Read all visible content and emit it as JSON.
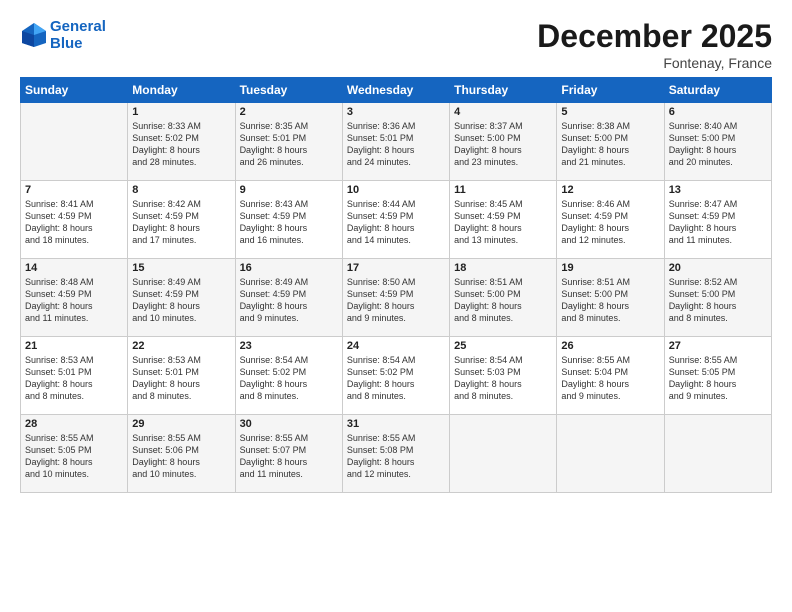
{
  "header": {
    "logo_line1": "General",
    "logo_line2": "Blue",
    "month": "December 2025",
    "location": "Fontenay, France"
  },
  "days_of_week": [
    "Sunday",
    "Monday",
    "Tuesday",
    "Wednesday",
    "Thursday",
    "Friday",
    "Saturday"
  ],
  "weeks": [
    [
      {
        "day": "",
        "info": ""
      },
      {
        "day": "1",
        "info": "Sunrise: 8:33 AM\nSunset: 5:02 PM\nDaylight: 8 hours\nand 28 minutes."
      },
      {
        "day": "2",
        "info": "Sunrise: 8:35 AM\nSunset: 5:01 PM\nDaylight: 8 hours\nand 26 minutes."
      },
      {
        "day": "3",
        "info": "Sunrise: 8:36 AM\nSunset: 5:01 PM\nDaylight: 8 hours\nand 24 minutes."
      },
      {
        "day": "4",
        "info": "Sunrise: 8:37 AM\nSunset: 5:00 PM\nDaylight: 8 hours\nand 23 minutes."
      },
      {
        "day": "5",
        "info": "Sunrise: 8:38 AM\nSunset: 5:00 PM\nDaylight: 8 hours\nand 21 minutes."
      },
      {
        "day": "6",
        "info": "Sunrise: 8:40 AM\nSunset: 5:00 PM\nDaylight: 8 hours\nand 20 minutes."
      }
    ],
    [
      {
        "day": "7",
        "info": "Sunrise: 8:41 AM\nSunset: 4:59 PM\nDaylight: 8 hours\nand 18 minutes."
      },
      {
        "day": "8",
        "info": "Sunrise: 8:42 AM\nSunset: 4:59 PM\nDaylight: 8 hours\nand 17 minutes."
      },
      {
        "day": "9",
        "info": "Sunrise: 8:43 AM\nSunset: 4:59 PM\nDaylight: 8 hours\nand 16 minutes."
      },
      {
        "day": "10",
        "info": "Sunrise: 8:44 AM\nSunset: 4:59 PM\nDaylight: 8 hours\nand 14 minutes."
      },
      {
        "day": "11",
        "info": "Sunrise: 8:45 AM\nSunset: 4:59 PM\nDaylight: 8 hours\nand 13 minutes."
      },
      {
        "day": "12",
        "info": "Sunrise: 8:46 AM\nSunset: 4:59 PM\nDaylight: 8 hours\nand 12 minutes."
      },
      {
        "day": "13",
        "info": "Sunrise: 8:47 AM\nSunset: 4:59 PM\nDaylight: 8 hours\nand 11 minutes."
      }
    ],
    [
      {
        "day": "14",
        "info": "Sunrise: 8:48 AM\nSunset: 4:59 PM\nDaylight: 8 hours\nand 11 minutes."
      },
      {
        "day": "15",
        "info": "Sunrise: 8:49 AM\nSunset: 4:59 PM\nDaylight: 8 hours\nand 10 minutes."
      },
      {
        "day": "16",
        "info": "Sunrise: 8:49 AM\nSunset: 4:59 PM\nDaylight: 8 hours\nand 9 minutes."
      },
      {
        "day": "17",
        "info": "Sunrise: 8:50 AM\nSunset: 4:59 PM\nDaylight: 8 hours\nand 9 minutes."
      },
      {
        "day": "18",
        "info": "Sunrise: 8:51 AM\nSunset: 5:00 PM\nDaylight: 8 hours\nand 8 minutes."
      },
      {
        "day": "19",
        "info": "Sunrise: 8:51 AM\nSunset: 5:00 PM\nDaylight: 8 hours\nand 8 minutes."
      },
      {
        "day": "20",
        "info": "Sunrise: 8:52 AM\nSunset: 5:00 PM\nDaylight: 8 hours\nand 8 minutes."
      }
    ],
    [
      {
        "day": "21",
        "info": "Sunrise: 8:53 AM\nSunset: 5:01 PM\nDaylight: 8 hours\nand 8 minutes."
      },
      {
        "day": "22",
        "info": "Sunrise: 8:53 AM\nSunset: 5:01 PM\nDaylight: 8 hours\nand 8 minutes."
      },
      {
        "day": "23",
        "info": "Sunrise: 8:54 AM\nSunset: 5:02 PM\nDaylight: 8 hours\nand 8 minutes."
      },
      {
        "day": "24",
        "info": "Sunrise: 8:54 AM\nSunset: 5:02 PM\nDaylight: 8 hours\nand 8 minutes."
      },
      {
        "day": "25",
        "info": "Sunrise: 8:54 AM\nSunset: 5:03 PM\nDaylight: 8 hours\nand 8 minutes."
      },
      {
        "day": "26",
        "info": "Sunrise: 8:55 AM\nSunset: 5:04 PM\nDaylight: 8 hours\nand 9 minutes."
      },
      {
        "day": "27",
        "info": "Sunrise: 8:55 AM\nSunset: 5:05 PM\nDaylight: 8 hours\nand 9 minutes."
      }
    ],
    [
      {
        "day": "28",
        "info": "Sunrise: 8:55 AM\nSunset: 5:05 PM\nDaylight: 8 hours\nand 10 minutes."
      },
      {
        "day": "29",
        "info": "Sunrise: 8:55 AM\nSunset: 5:06 PM\nDaylight: 8 hours\nand 10 minutes."
      },
      {
        "day": "30",
        "info": "Sunrise: 8:55 AM\nSunset: 5:07 PM\nDaylight: 8 hours\nand 11 minutes."
      },
      {
        "day": "31",
        "info": "Sunrise: 8:55 AM\nSunset: 5:08 PM\nDaylight: 8 hours\nand 12 minutes."
      },
      {
        "day": "",
        "info": ""
      },
      {
        "day": "",
        "info": ""
      },
      {
        "day": "",
        "info": ""
      }
    ]
  ]
}
